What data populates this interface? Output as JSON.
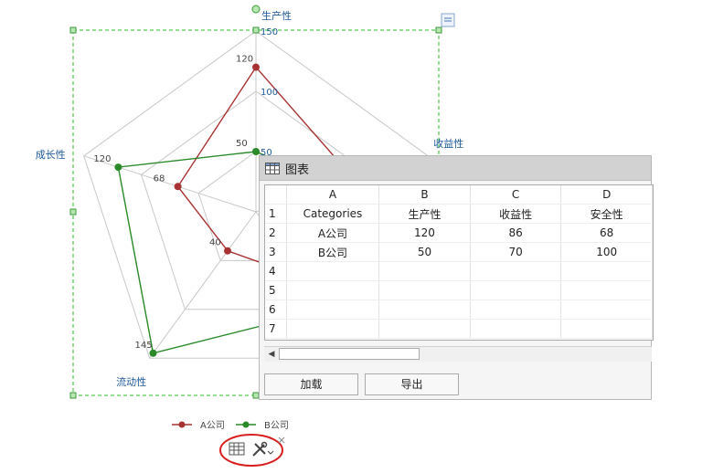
{
  "chart_data": {
    "type": "radar",
    "axes": [
      "生产性",
      "收益性",
      "安全性",
      "流动性",
      "成长性"
    ],
    "scale": {
      "min": 0,
      "max": 150,
      "ticks": [
        50,
        100,
        150
      ]
    },
    "series": [
      {
        "name": "A公司",
        "color": "#a83232",
        "values": [
          120,
          86,
          68,
          40,
          68
        ]
      },
      {
        "name": "B公司",
        "color": "#2a8a2a",
        "values": [
          50,
          70,
          100,
          145,
          120
        ]
      }
    ],
    "visible_point_labels": [
      {
        "series": 0,
        "axis": 0,
        "text": "120"
      },
      {
        "series": 0,
        "axis": 4,
        "text": "68"
      },
      {
        "series": 0,
        "axis": 3,
        "text": "40"
      },
      {
        "series": 1,
        "axis": 0,
        "text": "50"
      },
      {
        "series": 1,
        "axis": 4,
        "text": "120"
      },
      {
        "series": 1,
        "axis": 3,
        "text": "145"
      }
    ],
    "legend_position": "bottom-left"
  },
  "data_window": {
    "title": "图表",
    "column_headers": [
      "A",
      "B",
      "C",
      "D"
    ],
    "rows": [
      {
        "num": "1",
        "cells": [
          "Categories",
          "生产性",
          "收益性",
          "安全性"
        ]
      },
      {
        "num": "2",
        "cells": [
          "A公司",
          "120",
          "86",
          "68"
        ]
      },
      {
        "num": "3",
        "cells": [
          "B公司",
          "50",
          "70",
          "100"
        ]
      },
      {
        "num": "4",
        "cells": [
          "",
          "",
          "",
          ""
        ]
      },
      {
        "num": "5",
        "cells": [
          "",
          "",
          "",
          ""
        ]
      },
      {
        "num": "6",
        "cells": [
          "",
          "",
          "",
          ""
        ]
      },
      {
        "num": "7",
        "cells": [
          "",
          "",
          "",
          ""
        ]
      }
    ],
    "load_label": "加载",
    "export_label": "导出"
  },
  "toolbar": {
    "icons": [
      "table-icon",
      "tools-icon"
    ]
  },
  "colors": {
    "selection": "#2bbf2b",
    "grid": "#c8c8c8",
    "axis_label": "#1f5a9a",
    "highlight_circle": "#d81e1e"
  }
}
